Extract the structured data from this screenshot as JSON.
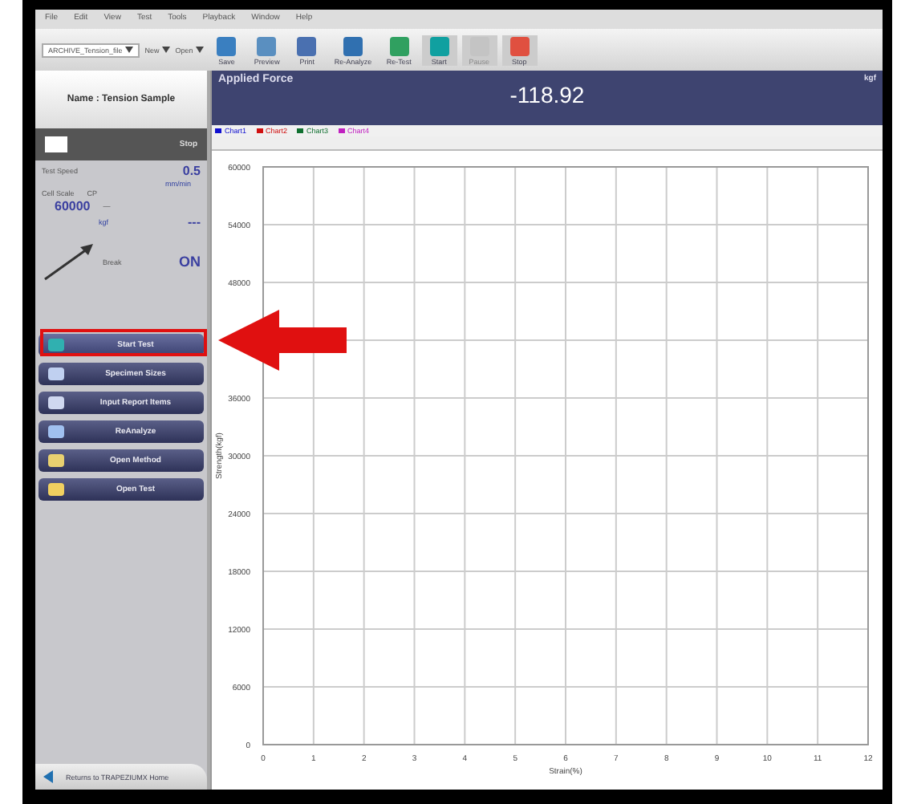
{
  "menu": [
    "File",
    "Edit",
    "View",
    "Test",
    "Tools",
    "Playback",
    "Window",
    "Help"
  ],
  "toolbar": {
    "file_combo": "ARCHIVE_Tension_file",
    "new": "New",
    "open": "Open",
    "buttons": [
      {
        "label": "Save",
        "kind": "save",
        "disabled": false
      },
      {
        "label": "Preview",
        "kind": "preview",
        "disabled": false
      },
      {
        "label": "Print",
        "kind": "print",
        "disabled": false
      },
      {
        "label": "Re-Analyze",
        "kind": "reanalyze",
        "disabled": false
      },
      {
        "label": "Re-Test",
        "kind": "retest",
        "disabled": false
      },
      {
        "label": "Start",
        "kind": "start",
        "disabled": false
      },
      {
        "label": "Pause",
        "kind": "pause",
        "disabled": true
      },
      {
        "label": "Stop",
        "kind": "stop",
        "disabled": false
      }
    ]
  },
  "sidebar": {
    "title": "Name : Tension Sample",
    "stop_label": "Stop",
    "test_speed": {
      "label": "Test Speed",
      "value": "0.5",
      "unit": "mm/min"
    },
    "cell_scale": {
      "label": "Cell Scale",
      "code": "CP",
      "value": "60000",
      "dash": "—",
      "unit": "kgf",
      "reading": "---"
    },
    "break": {
      "label": "Break",
      "value": "ON"
    },
    "buttons": [
      {
        "label": "Start Test",
        "kind": "start",
        "selected": true
      },
      {
        "label": "Specimen Sizes",
        "kind": "sizes",
        "selected": false
      },
      {
        "label": "Input Report Items",
        "kind": "report",
        "selected": false
      },
      {
        "label": "ReAnalyze",
        "kind": "reanalyze",
        "selected": false
      },
      {
        "label": "Open Method",
        "kind": "method",
        "selected": false
      },
      {
        "label": "Open Test",
        "kind": "test",
        "selected": false
      }
    ],
    "home": "Returns to TRAPEZIUMX Home"
  },
  "display": {
    "title": "Applied Force",
    "unit": "kgf",
    "value": "-118.92"
  },
  "legend": [
    {
      "label": "Chart1",
      "color": "#1010d0"
    },
    {
      "label": "Chart2",
      "color": "#d01010"
    },
    {
      "label": "Chart3",
      "color": "#107030"
    },
    {
      "label": "Chart4",
      "color": "#c020c0"
    }
  ],
  "chart_data": {
    "type": "line",
    "grid": true,
    "xlabel": "Strain(%)",
    "ylabel": "Strength(kgf)",
    "xlim": [
      0,
      12
    ],
    "ylim": [
      0,
      60000
    ],
    "xticks": [
      0,
      1,
      2,
      3,
      4,
      5,
      6,
      7,
      8,
      9,
      10,
      11,
      12
    ],
    "yticks": [
      0,
      6000,
      12000,
      18000,
      24000,
      30000,
      36000,
      48000,
      54000,
      60000
    ]
  }
}
